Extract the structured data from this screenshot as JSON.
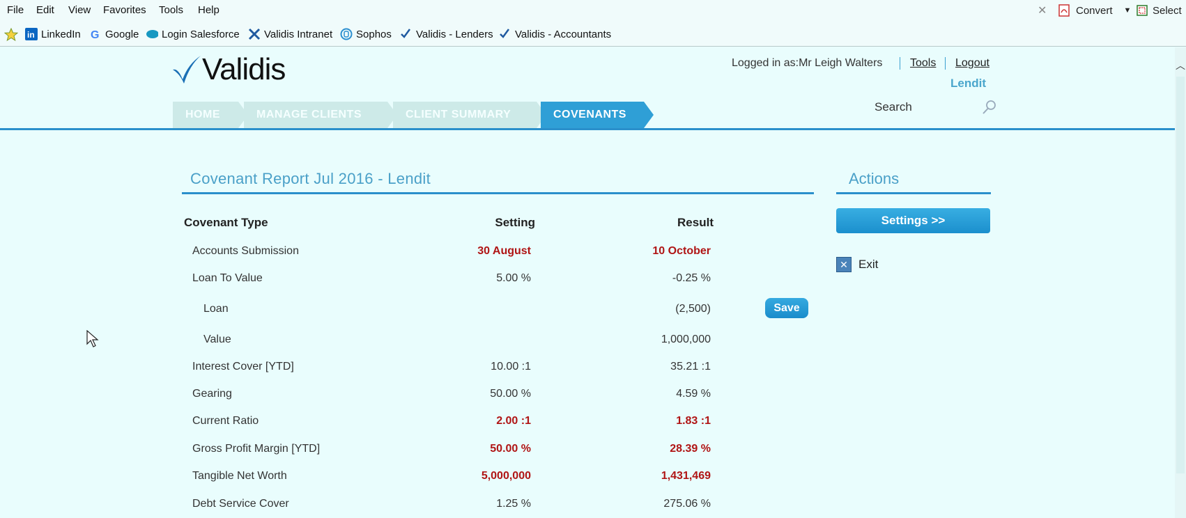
{
  "menubar": {
    "items": [
      "File",
      "Edit",
      "View",
      "Favorites",
      "Tools",
      "Help"
    ],
    "convert_label": "Convert",
    "select_label": "Select"
  },
  "favorites": {
    "items": [
      "LinkedIn",
      "Google",
      "Login Salesforce",
      "Validis Intranet",
      "Sophos",
      "Validis - Lenders",
      "Validis - Accountants"
    ]
  },
  "header": {
    "logo_text": "Validis",
    "logged_in": "Logged in as:Mr Leigh Walters",
    "tools_link": "Tools",
    "logout_link": "Logout",
    "client_name": "Lendit",
    "search_label": "Search"
  },
  "nav": {
    "crumbs": [
      "HOME",
      "MANAGE CLIENTS",
      "CLIENT SUMMARY",
      "COVENANTS"
    ]
  },
  "report": {
    "title": "Covenant Report Jul 2016 - Lendit",
    "headers": {
      "type": "Covenant Type",
      "setting": "Setting",
      "result": "Result"
    },
    "rows": [
      {
        "type": "Accounts Submission",
        "setting": "30 August",
        "result": "10 October",
        "breach": true
      },
      {
        "type": "Loan To Value",
        "setting": "5.00 %",
        "result": "-0.25 %",
        "breach": false
      },
      {
        "type": "Loan",
        "setting": "",
        "result": "(2,500)",
        "breach": false
      },
      {
        "type": "Value",
        "setting": "",
        "result": "1,000,000",
        "breach": false
      },
      {
        "type": "Interest Cover [YTD]",
        "setting": "10.00 :1",
        "result": "35.21 :1",
        "breach": false
      },
      {
        "type": "Gearing",
        "setting": "50.00 %",
        "result": "4.59 %",
        "breach": false
      },
      {
        "type": "Current Ratio",
        "setting": "2.00 :1",
        "result": "1.83 :1",
        "breach": true
      },
      {
        "type": "Gross Profit Margin [YTD]",
        "setting": "50.00 %",
        "result": "28.39 %",
        "breach": true
      },
      {
        "type": "Tangible Net Worth",
        "setting": "5,000,000",
        "result": "1,431,469",
        "breach": true
      },
      {
        "type": "Debt Service Cover",
        "setting": "1.25 %",
        "result": "275.06 %",
        "breach": false
      }
    ],
    "save_label": "Save"
  },
  "actions": {
    "title": "Actions",
    "settings_label": "Settings >>",
    "exit_label": "Exit"
  },
  "colors": {
    "accent": "#2a8fcb",
    "breach": "#b01515",
    "background": "#e9fdfd"
  }
}
